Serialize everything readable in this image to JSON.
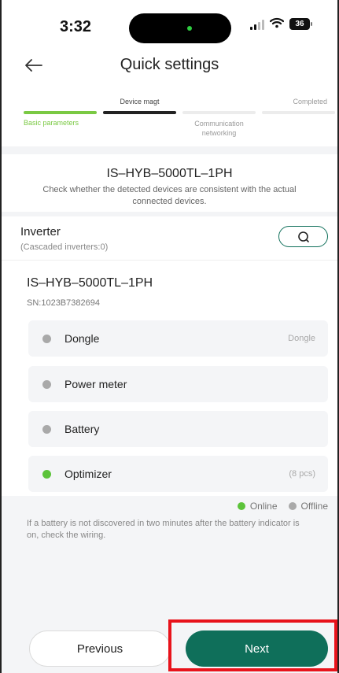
{
  "status_bar": {
    "time": "3:32",
    "battery": "36"
  },
  "header": {
    "title": "Quick settings",
    "back_icon": "back-arrow-icon"
  },
  "stepper": {
    "steps": [
      {
        "label": "Basic parameters",
        "state": "completed"
      },
      {
        "label": "Device magt",
        "state": "current"
      },
      {
        "label": "Communication networking",
        "state": "pending"
      },
      {
        "label": "Completed",
        "state": "pending"
      }
    ],
    "colors": {
      "completed": "#7ac943",
      "current": "#222222",
      "pending": "#ececec"
    }
  },
  "device_header": {
    "model": "IS–HYB–5000TL–1PH",
    "hint": "Check whether the detected devices are consistent with the actual connected devices."
  },
  "inverter": {
    "label": "Inverter",
    "cascaded": "(Cascaded inverters:0)",
    "model": "IS–HYB–5000TL–1PH",
    "sn": "SN:1023B7382694",
    "search_icon": "search-icon"
  },
  "devices": [
    {
      "name": "Dongle",
      "extra": "Dongle",
      "status": "offline"
    },
    {
      "name": "Power meter",
      "extra": "",
      "status": "offline"
    },
    {
      "name": "Battery",
      "extra": "",
      "status": "offline"
    },
    {
      "name": "Optimizer",
      "extra": "(8 pcs)",
      "status": "online"
    }
  ],
  "legend": {
    "online": "Online",
    "offline": "Offline",
    "online_color": "#5cc33a",
    "offline_color": "#a9a9a9"
  },
  "note": "If a battery is not discovered in two minutes after the battery indicator is on, check the wiring.",
  "footer": {
    "previous": "Previous",
    "next": "Next",
    "accent": "#0f6f5a",
    "highlight": "#e8131b"
  }
}
